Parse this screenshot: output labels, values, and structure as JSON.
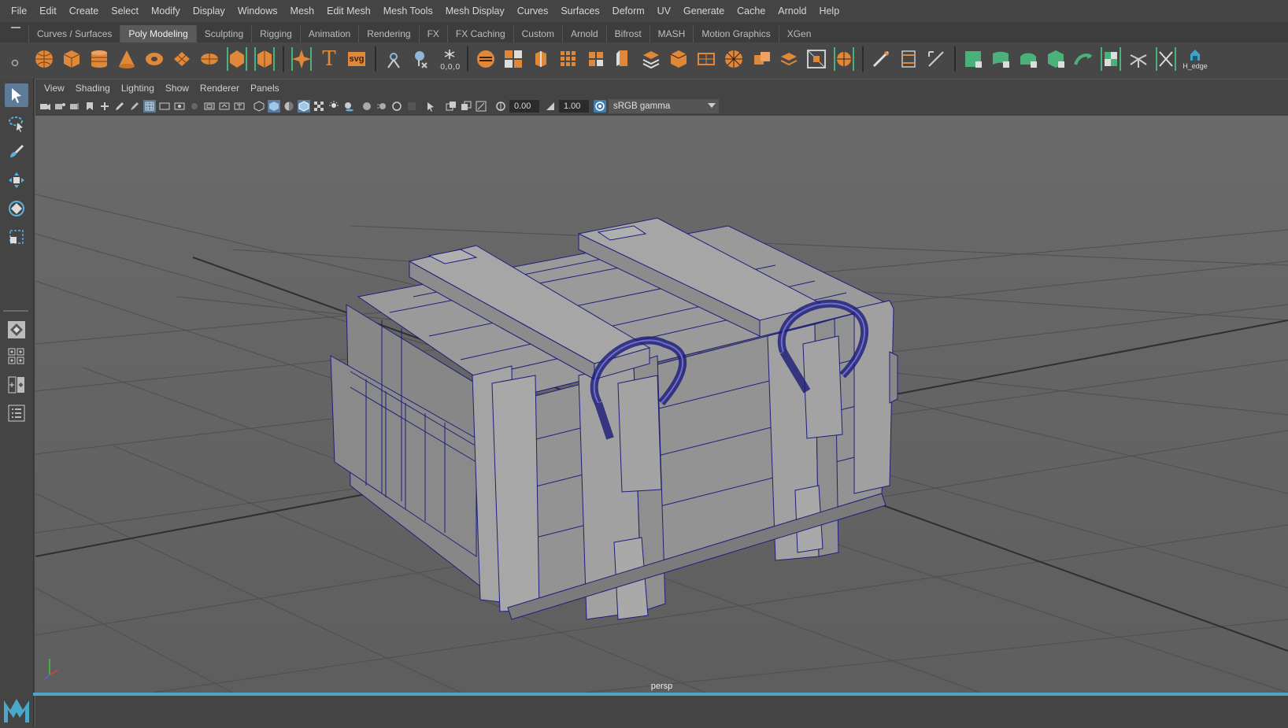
{
  "menubar": {
    "items": [
      "File",
      "Edit",
      "Create",
      "Select",
      "Modify",
      "Display",
      "Windows",
      "Mesh",
      "Edit Mesh",
      "Mesh Tools",
      "Mesh Display",
      "Curves",
      "Surfaces",
      "Deform",
      "UV",
      "Generate",
      "Cache",
      "Arnold",
      "Help"
    ]
  },
  "shelf_tabs": {
    "items": [
      "Curves / Surfaces",
      "Poly Modeling",
      "Sculpting",
      "Rigging",
      "Animation",
      "Rendering",
      "FX",
      "FX Caching",
      "Custom",
      "Arnold",
      "Bifrost",
      "MASH",
      "Motion Graphics",
      "XGen"
    ],
    "active": "Poly Modeling"
  },
  "shelf": {
    "text_icon": "T",
    "svg_icon": "svg",
    "h_edge_label": "H_edge",
    "icons": [
      "poly-sphere-icon",
      "poly-cube-icon",
      "poly-cylinder-icon",
      "poly-cone-icon",
      "poly-torus-icon",
      "poly-plane-icon",
      "poly-disc-icon",
      "platonic-icon",
      "super-shape-icon",
      "type-icon",
      "svg-icon",
      "measure-icon",
      "make-live-icon",
      "snap-origin-icon",
      "combine-icon",
      "separate-icon",
      "extract-icon",
      "smooth-icon",
      "mirror-icon",
      "bevel-icon",
      "bridge-icon",
      "extrude-icon",
      "append-icon",
      "fill-hole-icon",
      "multi-cut-icon",
      "target-weld-icon",
      "connect-icon",
      "quad-draw-icon",
      "insert-edge-loop-icon",
      "offset-edge-loop-icon",
      "cut-faces-icon",
      "uv-editor-icon",
      "planar-map-icon",
      "auto-map-icon",
      "cylindrical-map-icon",
      "sew-uv-icon",
      "unfold-icon",
      "checker-icon",
      "h-edge-icon"
    ]
  },
  "panel": {
    "menu": [
      "View",
      "Shading",
      "Lighting",
      "Show",
      "Renderer",
      "Panels"
    ],
    "exposure": "0.00",
    "gamma": "1.00",
    "color_space": "sRGB gamma",
    "camera_label": "persp"
  },
  "colors": {
    "accent": "#4ea4c7",
    "tool_selected": "#5d7a99",
    "shelf_orange": "#e0883a",
    "shelf_green": "#4bb07a",
    "wire": "#1c1c7a",
    "model": "#8f8f8f",
    "viewport_bg": "#6b6b6b"
  },
  "tools": [
    "select-tool-icon",
    "lasso-tool-icon",
    "paint-select-icon",
    "move-tool-icon",
    "rotate-tool-icon",
    "scale-tool-icon"
  ]
}
